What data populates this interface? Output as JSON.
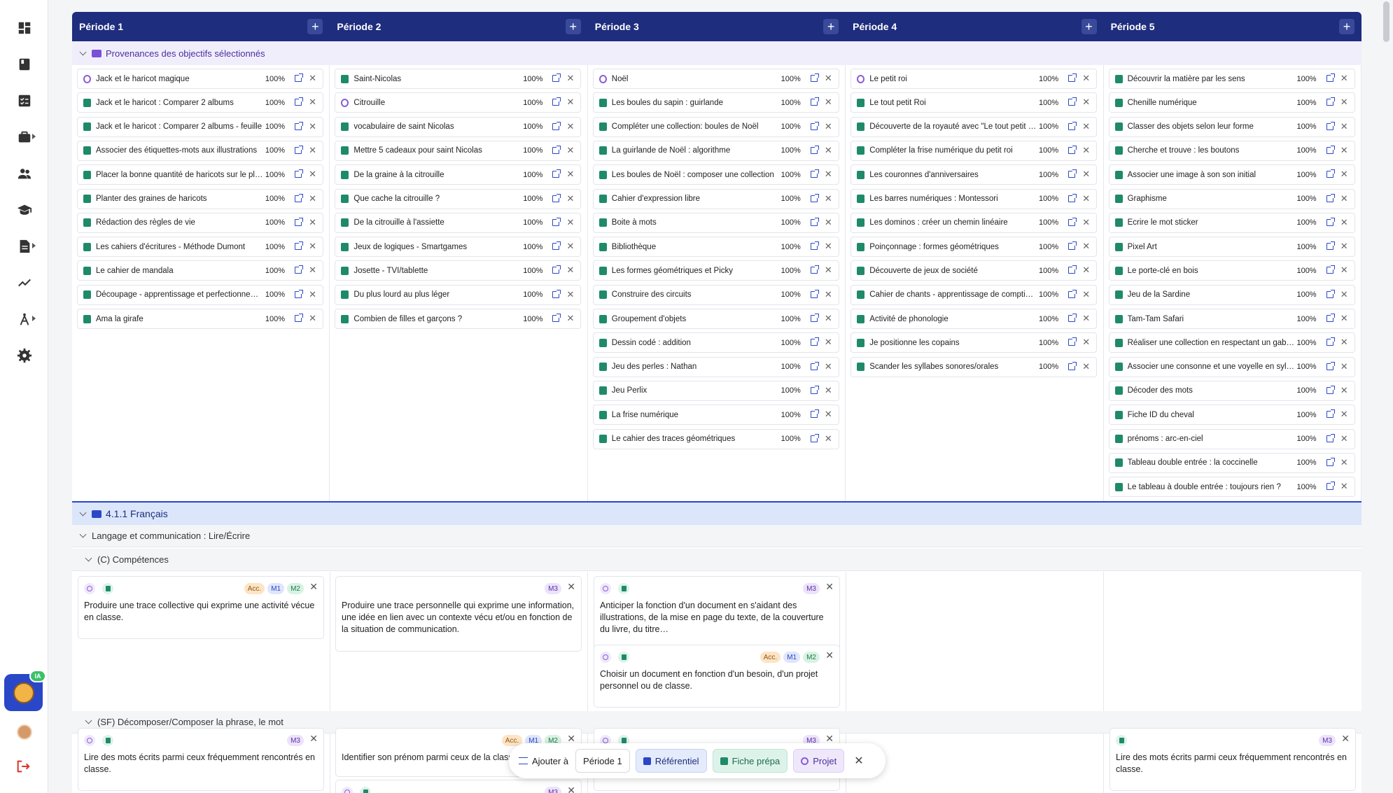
{
  "periods": [
    "Période 1",
    "Période 2",
    "Période 3",
    "Période 4",
    "Période 5"
  ],
  "provenance_title": "Provenances des objectifs sélectionnés",
  "columns": [
    [
      {
        "t": "p",
        "label": "Jack et le haricot magique",
        "pct": "100%"
      },
      {
        "t": "f",
        "label": "Jack et le haricot : Comparer 2 albums",
        "pct": "100%"
      },
      {
        "t": "f",
        "label": "Jack et le haricot : Comparer 2 albums - feuille",
        "pct": "100%"
      },
      {
        "t": "f",
        "label": "Associer des étiquettes-mots aux illustrations",
        "pct": "100%"
      },
      {
        "t": "f",
        "label": "Placer la bonne quantité de haricots sur le plateau",
        "pct": "100%"
      },
      {
        "t": "f",
        "label": "Planter des graines de haricots",
        "pct": "100%"
      },
      {
        "t": "f",
        "label": "Rédaction des règles de vie",
        "pct": "100%"
      },
      {
        "t": "f",
        "label": "Les cahiers d'écritures - Méthode Dumont",
        "pct": "100%"
      },
      {
        "t": "f",
        "label": "Le cahier de mandala",
        "pct": "100%"
      },
      {
        "t": "f",
        "label": "Découpage - apprentissage et perfectionnement",
        "pct": "100%"
      },
      {
        "t": "f",
        "label": "Ama la girafe",
        "pct": "100%"
      }
    ],
    [
      {
        "t": "f",
        "label": "Saint-Nicolas",
        "pct": "100%"
      },
      {
        "t": "p",
        "label": "Citrouille",
        "pct": "100%"
      },
      {
        "t": "f",
        "label": "vocabulaire de saint Nicolas",
        "pct": "100%"
      },
      {
        "t": "f",
        "label": "Mettre 5 cadeaux pour saint Nicolas",
        "pct": "100%"
      },
      {
        "t": "f",
        "label": "De la graine à la citrouille",
        "pct": "100%"
      },
      {
        "t": "f",
        "label": "Que cache la citrouille ?",
        "pct": "100%"
      },
      {
        "t": "f",
        "label": "De la citrouille à l'assiette",
        "pct": "100%"
      },
      {
        "t": "f",
        "label": "Jeux de logiques - Smartgames",
        "pct": "100%"
      },
      {
        "t": "f",
        "label": "Josette - TVI/tablette",
        "pct": "100%"
      },
      {
        "t": "f",
        "label": "Du plus lourd au plus léger",
        "pct": "100%"
      },
      {
        "t": "f",
        "label": "Combien de filles et garçons ?",
        "pct": "100%"
      }
    ],
    [
      {
        "t": "p",
        "label": "Noël",
        "pct": "100%"
      },
      {
        "t": "f",
        "label": "Les boules du sapin : guirlande",
        "pct": "100%"
      },
      {
        "t": "f",
        "label": "Compléter une collection: boules de Noël",
        "pct": "100%"
      },
      {
        "t": "f",
        "label": "La guirlande de Noël : algorithme",
        "pct": "100%"
      },
      {
        "t": "f",
        "label": "Les boules de Noël : composer une collection",
        "pct": "100%"
      },
      {
        "t": "f",
        "label": "Cahier d'expression libre",
        "pct": "100%"
      },
      {
        "t": "f",
        "label": "Boite à mots",
        "pct": "100%"
      },
      {
        "t": "f",
        "label": "Bibliothèque",
        "pct": "100%"
      },
      {
        "t": "f",
        "label": "Les formes géométriques et Picky",
        "pct": "100%"
      },
      {
        "t": "f",
        "label": "Construire des circuits",
        "pct": "100%"
      },
      {
        "t": "f",
        "label": "Groupement d'objets",
        "pct": "100%"
      },
      {
        "t": "f",
        "label": "Dessin codé : addition",
        "pct": "100%"
      },
      {
        "t": "f",
        "label": "Jeu des perles : Nathan",
        "pct": "100%"
      },
      {
        "t": "f",
        "label": "Jeu Perlix",
        "pct": "100%"
      },
      {
        "t": "f",
        "label": "La frise numérique",
        "pct": "100%"
      },
      {
        "t": "f",
        "label": "Le cahier des traces géométriques",
        "pct": "100%"
      }
    ],
    [
      {
        "t": "p",
        "label": "Le petit roi",
        "pct": "100%"
      },
      {
        "t": "f",
        "label": "Le tout petit Roi",
        "pct": "100%"
      },
      {
        "t": "f",
        "label": "Découverte de la royauté avec \"Le tout petit roi\"",
        "pct": "100%"
      },
      {
        "t": "f",
        "label": "Compléter la frise numérique du petit roi",
        "pct": "100%"
      },
      {
        "t": "f",
        "label": "Les couronnes d'anniversaires",
        "pct": "100%"
      },
      {
        "t": "f",
        "label": "Les barres numériques : Montessori",
        "pct": "100%"
      },
      {
        "t": "f",
        "label": "Les dominos : créer un chemin linéaire",
        "pct": "100%"
      },
      {
        "t": "f",
        "label": "Poinçonnage : formes géométriques",
        "pct": "100%"
      },
      {
        "t": "f",
        "label": "Découverte de jeux de société",
        "pct": "100%"
      },
      {
        "t": "f",
        "label": "Cahier de chants - apprentissage de comptines",
        "pct": "100%"
      },
      {
        "t": "f",
        "label": "Activité de phonologie",
        "pct": "100%"
      },
      {
        "t": "f",
        "label": "Je positionne les copains",
        "pct": "100%"
      },
      {
        "t": "f",
        "label": "Scander les syllabes sonores/orales",
        "pct": "100%"
      }
    ],
    [
      {
        "t": "f",
        "label": "Découvrir la matière par les sens",
        "pct": "100%"
      },
      {
        "t": "f",
        "label": "Chenille numérique",
        "pct": "100%"
      },
      {
        "t": "f",
        "label": "Classer des objets selon leur forme",
        "pct": "100%"
      },
      {
        "t": "f",
        "label": "Cherche et trouve : les boutons",
        "pct": "100%"
      },
      {
        "t": "f",
        "label": "Associer une image à son son initial",
        "pct": "100%"
      },
      {
        "t": "f",
        "label": "Graphisme",
        "pct": "100%"
      },
      {
        "t": "f",
        "label": "Écrire le mot sticker",
        "pct": "100%"
      },
      {
        "t": "f",
        "label": "Pixel Art",
        "pct": "100%"
      },
      {
        "t": "f",
        "label": "Le porte-clé en bois",
        "pct": "100%"
      },
      {
        "t": "f",
        "label": "Jeu de la Sardine",
        "pct": "100%"
      },
      {
        "t": "f",
        "label": "Tam-Tam Safari",
        "pct": "100%"
      },
      {
        "t": "f",
        "label": "Réaliser une collection en respectant un gabarit",
        "pct": "100%"
      },
      {
        "t": "f",
        "label": "Associer une consonne et une voyelle en syllabe",
        "pct": "100%"
      },
      {
        "t": "f",
        "label": "Décoder des mots",
        "pct": "100%"
      },
      {
        "t": "f",
        "label": "Fiche ID du cheval",
        "pct": "100%"
      },
      {
        "t": "f",
        "label": "prénoms : arc-en-ciel",
        "pct": "100%"
      },
      {
        "t": "f",
        "label": "Tableau double entrée : la coccinelle",
        "pct": "100%"
      },
      {
        "t": "f",
        "label": "Le tableau à double entrée : toujours rien ?",
        "pct": "100%"
      }
    ]
  ],
  "section": {
    "title": "4.1.1 Français",
    "subsection": "Langage et communication : Lire/Écrire",
    "group1": "(C) Compétences",
    "group2": "(SF) Décomposer/Composer la phrase, le mot"
  },
  "competences": {
    "c1": {
      "text": "Produire une trace collective qui exprime une activité vécue en classe.",
      "tags": [
        "Acc.",
        "M1",
        "M2"
      ]
    },
    "c2": {
      "text": "Produire une trace personnelle qui exprime une information, une idée en lien avec un contexte vécu et/ou en fonction de la situation de communication.",
      "tags": [
        "M3"
      ]
    },
    "c3a": {
      "text": "Anticiper la fonction d'un document en s'aidant des illustrations, de la mise en page du texte, de la couverture du livre, du titre…",
      "tags": [
        "M3"
      ]
    },
    "c3b": {
      "text": "Choisir un document en fonction d'un besoin, d'un projet personnel ou de classe.",
      "tags": [
        "Acc.",
        "M1",
        "M2"
      ]
    },
    "s1": {
      "text": "Lire des mots écrits parmi ceux fréquemment rencontrés en classe.",
      "tags": [
        "M3"
      ]
    },
    "s2": {
      "text": "Identifier son prénom parmi ceux de la classe.",
      "tags": [
        "Acc.",
        "M1",
        "M2"
      ]
    },
    "s2b": {
      "tags": [
        "M3"
      ]
    },
    "s3": {
      "tags": [
        "M3"
      ]
    },
    "s5": {
      "text": "Lire des mots écrits parmi ceux fréquemment rencontrés en classe.",
      "tags": [
        "M3"
      ]
    }
  },
  "toolbar": {
    "add_label": "Ajouter à",
    "period_label": "Période 1",
    "ref_label": "Référentiel",
    "fiche_label": "Fiche prépa",
    "projet_label": "Projet"
  },
  "sidebar_badge": "IA",
  "icons": {
    "sidebar": [
      "dashboard-icon",
      "book-icon",
      "checklist-icon",
      "briefcase-icon",
      "users-icon",
      "graduation-cap-icon",
      "document-icon",
      "chart-line-icon",
      "compass-icon",
      "gear-icon"
    ]
  },
  "colors": {
    "header": "#1e2d7d",
    "accent": "#2a47c8",
    "project": "#8a5cd8",
    "fiche": "#1f8a6a"
  }
}
